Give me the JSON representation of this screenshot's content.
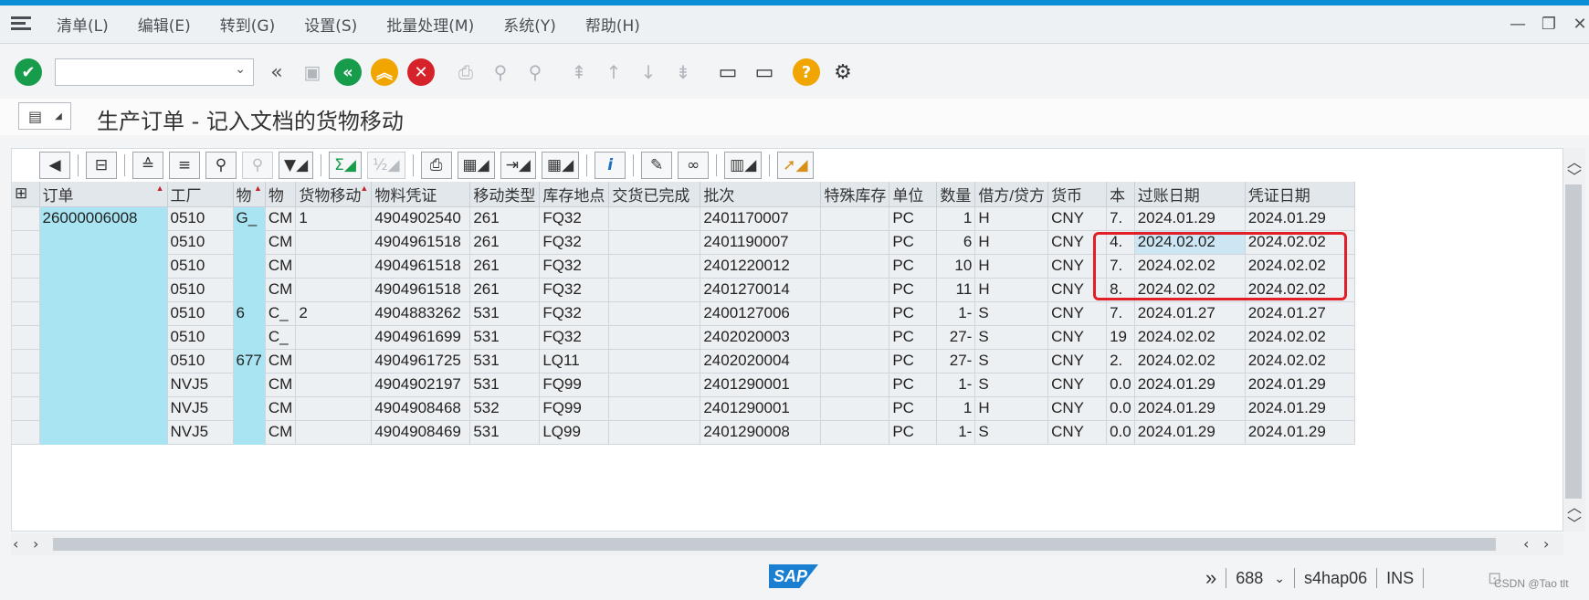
{
  "menu": {
    "items": [
      "清单(L)",
      "编辑(E)",
      "转到(G)",
      "设置(S)",
      "批量处理(M)",
      "系统(Y)",
      "帮助(H)"
    ]
  },
  "window": {
    "minimize": "—",
    "maximize": "❐",
    "close": "✕"
  },
  "toolbar": {
    "command_value": ""
  },
  "title": {
    "text": "生产订单 - 记入文档的货物移动"
  },
  "grid": {
    "columns": [
      "订单",
      "工厂",
      "物",
      "物",
      "货物移动",
      "物料凭证",
      "移动类型",
      "库存地点",
      "交货已完成",
      "批次",
      "特殊库存",
      "单位",
      "数量",
      "借方/贷方",
      "货币",
      "本",
      "过账日期",
      "凭证日期"
    ],
    "rows": [
      [
        "26000006008",
        "0510",
        "G_",
        "CM",
        "1",
        "4904902540",
        "261",
        "FQ32",
        "",
        "2401170007",
        "",
        "PC",
        "1",
        "H",
        "CNY",
        "7.",
        "2024.01.29",
        "2024.01.29"
      ],
      [
        "",
        "0510",
        "",
        "CM",
        "",
        "4904961518",
        "261",
        "FQ32",
        "",
        "2401190007",
        "",
        "PC",
        "6",
        "H",
        "CNY",
        "4.",
        "2024.02.02",
        "2024.02.02"
      ],
      [
        "",
        "0510",
        "",
        "CM",
        "",
        "4904961518",
        "261",
        "FQ32",
        "",
        "2401220012",
        "",
        "PC",
        "10",
        "H",
        "CNY",
        "7.",
        "2024.02.02",
        "2024.02.02"
      ],
      [
        "",
        "0510",
        "",
        "CM",
        "",
        "4904961518",
        "261",
        "FQ32",
        "",
        "2401270014",
        "",
        "PC",
        "11",
        "H",
        "CNY",
        "8.",
        "2024.02.02",
        "2024.02.02"
      ],
      [
        "",
        "0510",
        "6",
        "C_",
        "2",
        "4904883262",
        "531",
        "FQ32",
        "",
        "2400127006",
        "",
        "PC",
        "1-",
        "S",
        "CNY",
        "7.",
        "2024.01.27",
        "2024.01.27"
      ],
      [
        "",
        "0510",
        "",
        "C_",
        "",
        "4904961699",
        "531",
        "FQ32",
        "",
        "2402020003",
        "",
        "PC",
        "27-",
        "S",
        "CNY",
        "19",
        "2024.02.02",
        "2024.02.02"
      ],
      [
        "",
        "0510",
        "677",
        "CM",
        "",
        "4904961725",
        "531",
        "LQ11",
        "",
        "2402020004",
        "",
        "PC",
        "27-",
        "S",
        "CNY",
        "2.",
        "2024.02.02",
        "2024.02.02"
      ],
      [
        "",
        "NVJ5",
        "",
        "CM",
        "",
        "4904902197",
        "531",
        "FQ99",
        "",
        "2401290001",
        "",
        "PC",
        "1-",
        "S",
        "CNY",
        "0.0",
        "2024.01.29",
        "2024.01.29"
      ],
      [
        "",
        "NVJ5",
        "",
        "CM",
        "",
        "4904908468",
        "532",
        "FQ99",
        "",
        "2401290001",
        "",
        "PC",
        "1",
        "H",
        "CNY",
        "0.0",
        "2024.01.29",
        "2024.01.29"
      ],
      [
        "",
        "NVJ5",
        "",
        "CM",
        "",
        "4904908469",
        "531",
        "LQ99",
        "",
        "2401290008",
        "",
        "PC",
        "1-",
        "S",
        "CNY",
        "0.0",
        "2024.01.29",
        "2024.01.29"
      ]
    ]
  },
  "status": {
    "session": "688",
    "system": "s4hap06",
    "mode": "INS",
    "watermark": "CSDN @Tao tlt",
    "logo": "SAP"
  },
  "colors": {
    "accent": "#0a8fd6",
    "key_column": "#a9e4f2",
    "highlight_box": "#e21f26"
  }
}
